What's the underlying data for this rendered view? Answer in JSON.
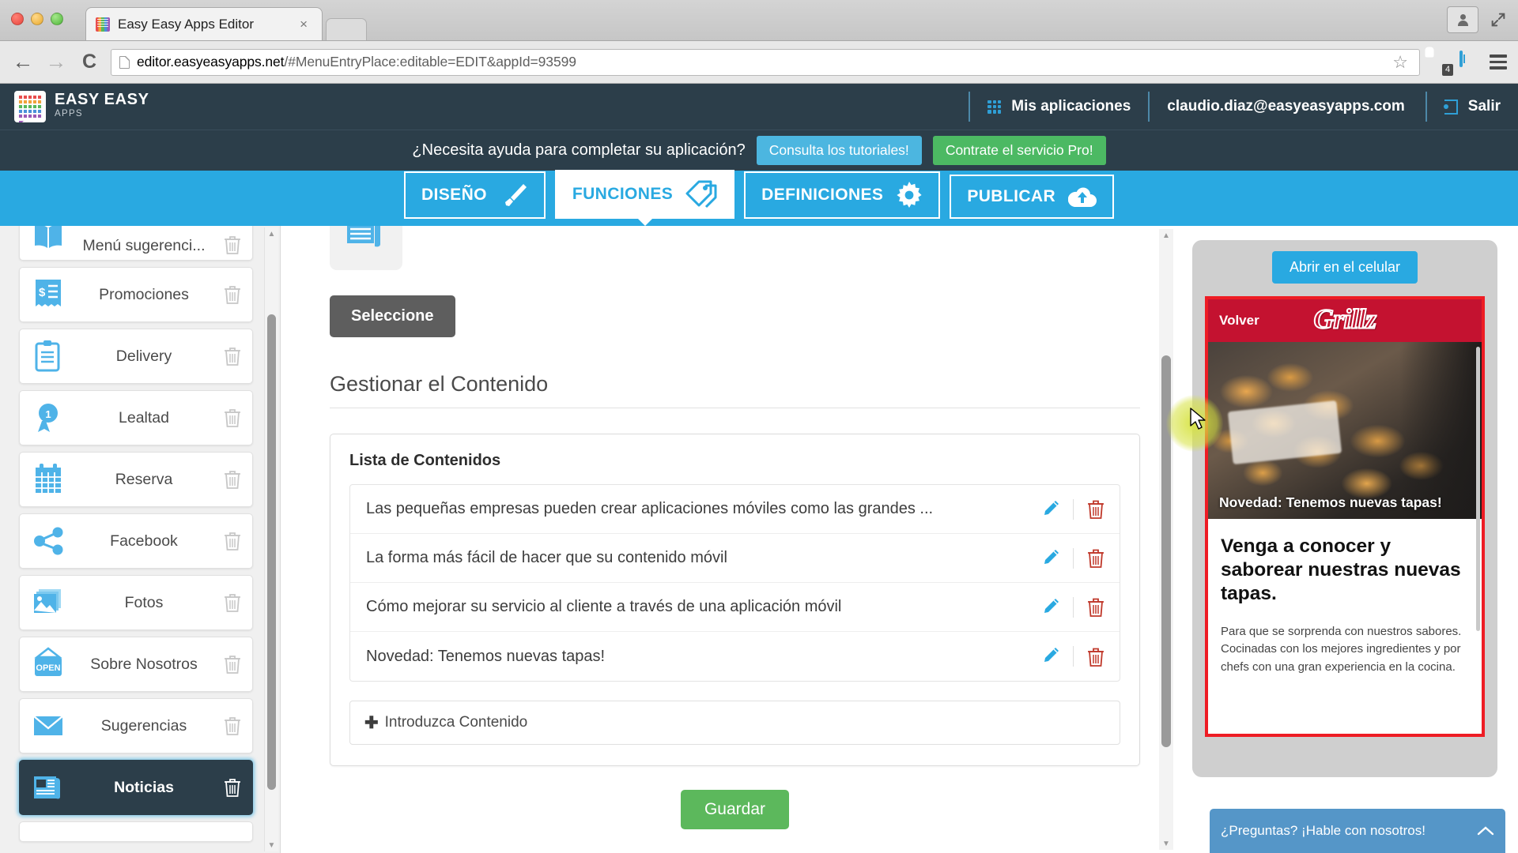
{
  "browser": {
    "tab_title": "Easy Easy Apps Editor",
    "tab_close": "×",
    "url_host": "editor.easyeasyapps.net",
    "url_path": "/#MenuEntryPlace:editable=EDIT&appId=93599",
    "back": "←",
    "forward": "→",
    "reload": "C",
    "star": "☆",
    "adblock_count": "4"
  },
  "header": {
    "logo_line1": "EASY EASY",
    "logo_line2": "APPS",
    "apps_label": "Mis aplicaciones",
    "email": "claudio.diaz@easyeasyapps.com",
    "logout_label": "Salir"
  },
  "help_bar": {
    "question": "¿Necesita ayuda para completar su aplicación?",
    "tutorials_label": "Consulta los tutoriales!",
    "pro_label": "Contrate el servicio Pro!"
  },
  "main_tabs": [
    {
      "label": "DISEÑO",
      "icon": "brush-icon",
      "active": false
    },
    {
      "label": "FUNCIONES",
      "icon": "tags-icon",
      "active": true
    },
    {
      "label": "DEFINICIONES",
      "icon": "gear-icon",
      "active": false
    },
    {
      "label": "PUBLICAR",
      "icon": "upload-cloud-icon",
      "active": false
    }
  ],
  "sidebar": {
    "items": [
      {
        "label": "Menú sugerenci...",
        "icon": "book-icon",
        "active": false
      },
      {
        "label": "Promociones",
        "icon": "receipt-icon",
        "active": false
      },
      {
        "label": "Delivery",
        "icon": "clipboard-icon",
        "active": false
      },
      {
        "label": "Lealtad",
        "icon": "award-ribbon-icon",
        "active": false
      },
      {
        "label": "Reserva",
        "icon": "calendar-icon",
        "active": false
      },
      {
        "label": "Facebook",
        "icon": "share-icon",
        "active": false
      },
      {
        "label": "Fotos",
        "icon": "photos-icon",
        "active": false
      },
      {
        "label": "Sobre Nosotros",
        "icon": "open-sign-icon",
        "active": false
      },
      {
        "label": "Sugerencias",
        "icon": "envelope-icon",
        "active": false
      },
      {
        "label": "Noticias",
        "icon": "newspaper-icon",
        "active": true
      }
    ],
    "delete_icon": "trash-icon"
  },
  "main": {
    "select_button": "Seleccione",
    "section_title": "Gestionar el Contenido",
    "panel_title": "Lista de Contenidos",
    "content_items": [
      "Las pequeñas empresas pueden crear aplicaciones móviles como las grandes ...",
      "La forma más fácil de hacer que su contenido móvil",
      "Cómo mejorar su servicio al cliente a través de una aplicación móvil",
      "Novedad: Tenemos nuevas tapas!"
    ],
    "add_plus": "➕",
    "add_label": "Introduzca Contenido",
    "save_button": "Guardar"
  },
  "preview": {
    "open_mobile_label": "Abrir en el celular",
    "app_back_label": "Volver",
    "app_brand": "Grillz",
    "hero_caption": "Novedad: Tenemos nuevas tapas!",
    "headline": "Venga a conocer y saborear nuestras nuevas tapas.",
    "paragraph": "Para que se sorprenda con nuestros sabores. Cocinadas con los mejores ingredientes y por chefs con una gran experiencia en la cocina."
  },
  "chat": {
    "label": "¿Preguntas? ¡Hable con nosotros!",
    "chevron": "⌃"
  },
  "colors": {
    "brand_blue": "#29a9e1",
    "dark_navy": "#2c3e4a",
    "green": "#5cb85c",
    "app_red": "#c41230",
    "preview_border": "#ee1c24"
  }
}
